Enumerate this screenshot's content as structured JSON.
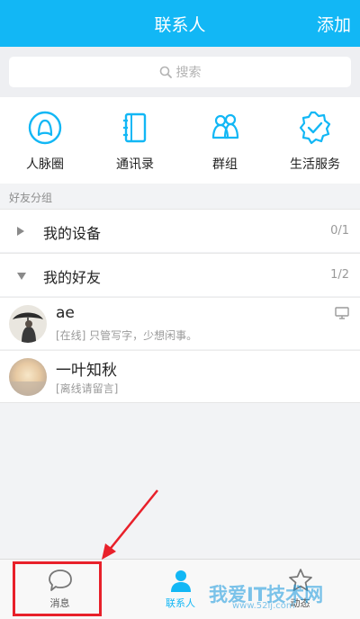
{
  "header": {
    "title": "联系人",
    "action": "添加"
  },
  "search": {
    "placeholder": "搜索"
  },
  "quick_entries": [
    {
      "label": "人脉圈",
      "icon": "people-circle-icon"
    },
    {
      "label": "通讯录",
      "icon": "address-book-icon"
    },
    {
      "label": "群组",
      "icon": "group-icon"
    },
    {
      "label": "生活服务",
      "icon": "service-badge-icon"
    }
  ],
  "section_label": "好友分组",
  "groups": [
    {
      "name": "我的设备",
      "count": "0/1",
      "expanded": false
    },
    {
      "name": "我的好友",
      "count": "1/2",
      "expanded": true
    }
  ],
  "contacts": [
    {
      "name": "ae",
      "status": "[在线] 只管写字，少想闲事。",
      "device": "desktop-icon"
    },
    {
      "name": "一叶知秋",
      "status": "[离线请留言]"
    }
  ],
  "tabs": [
    {
      "label": "消息",
      "icon": "chat-bubble-icon",
      "active": false
    },
    {
      "label": "联系人",
      "icon": "contacts-person-icon",
      "active": true
    },
    {
      "label": "动态",
      "icon": "star-icon",
      "active": false
    }
  ],
  "watermark": {
    "text": "我爱IT技术网",
    "url": "www.52ij.com"
  },
  "colors": {
    "accent": "#12b7f5",
    "annotation": "#e8202a"
  }
}
